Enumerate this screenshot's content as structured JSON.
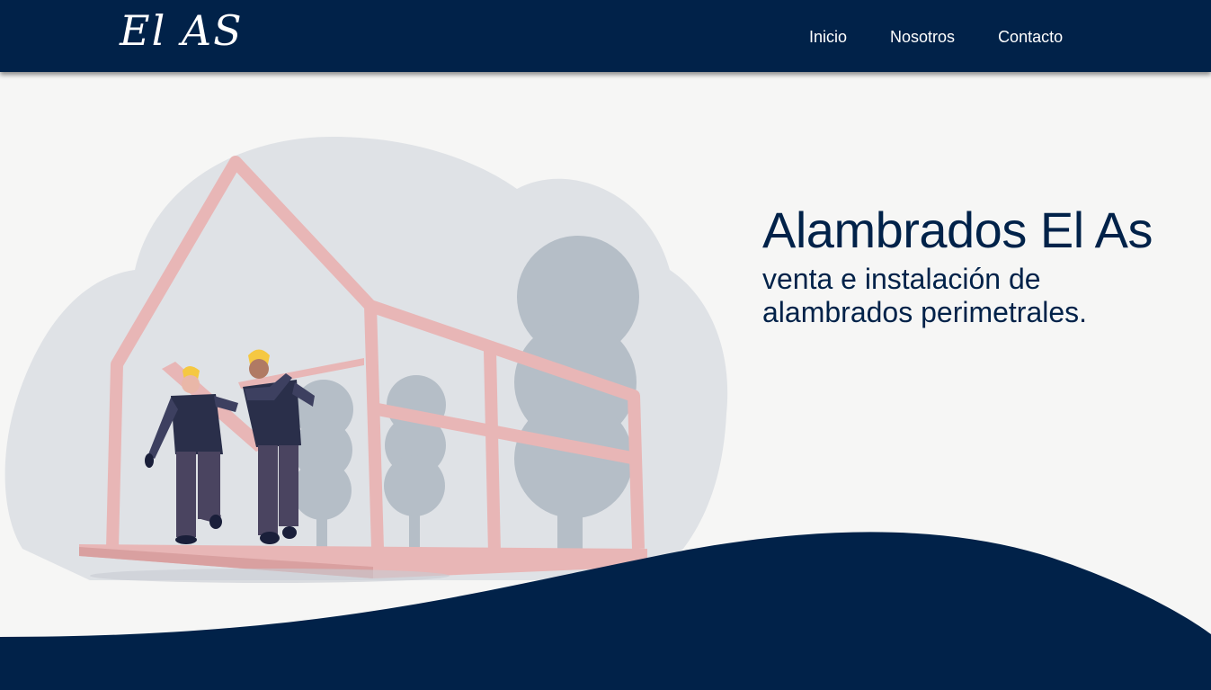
{
  "navbar": {
    "logo": "El AS",
    "links": [
      {
        "label": "Inicio"
      },
      {
        "label": "Nosotros"
      },
      {
        "label": "Contacto"
      }
    ]
  },
  "hero": {
    "title": "Alambrados El As",
    "subtitle_line1": "venta e instalación de",
    "subtitle_line2": "alambrados perimetrales."
  },
  "colors": {
    "navy": "#012249",
    "background": "#f6f6f5",
    "cloud": "#dfe2e6",
    "tree": "#b5bec7",
    "frame": "#e8b6b6",
    "helmet": "#f5c842"
  }
}
